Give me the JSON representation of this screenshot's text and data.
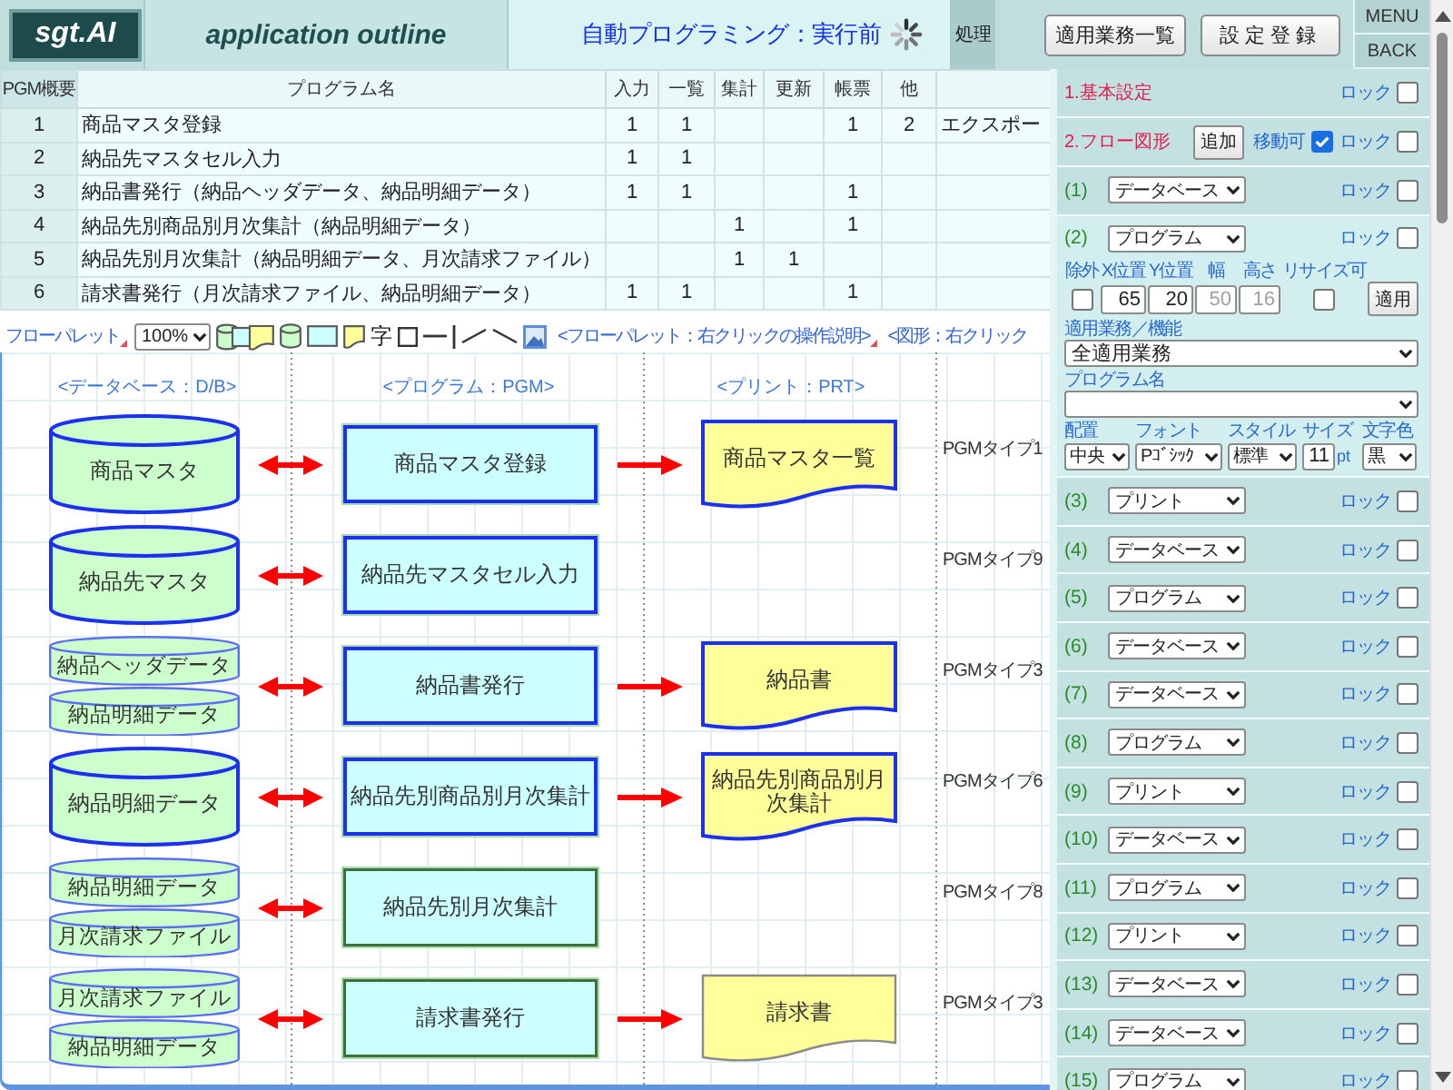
{
  "header": {
    "logo": "sgt.AI",
    "title": "application outline",
    "status": "自動プログラミング：実行前",
    "process_tab": "処理"
  },
  "header_buttons": [
    {
      "label": "適用業務一覧"
    },
    {
      "label": "設定登録"
    }
  ],
  "nav_buttons": [
    {
      "label": "MENU"
    },
    {
      "label": "BACK"
    }
  ],
  "program_table": {
    "columns": [
      "PGM概要",
      "プログラム名",
      "入力",
      "一覧",
      "集計",
      "更新",
      "帳票",
      "他"
    ],
    "rows": [
      {
        "number": "1",
        "name": "商品マスタ登録",
        "input": "1",
        "list": "1",
        "report": "1",
        "other": "2",
        "column_9": "エクスポー"
      },
      {
        "number": "2",
        "name": "納品先マスタセル入力",
        "input": "1",
        "list": "1"
      },
      {
        "number": "3",
        "name": "納品書発行（納品ヘッダデータ、納品明細データ）",
        "input": "1",
        "list": "1",
        "report": "1"
      },
      {
        "number": "4",
        "name": "納品先別商品別月次集計（納品明細データ）",
        "aggregate": "1",
        "report": "1"
      },
      {
        "number": "5",
        "name": "納品先別月次集計（納品明細データ、月次請求ファイル）",
        "aggregate": "1",
        "update": "1"
      },
      {
        "number": "6",
        "name": "請求書発行（月次請求ファイル、納品明細データ）",
        "input": "1",
        "list": "1",
        "report": "1"
      }
    ]
  },
  "flow_toolbar": {
    "label": {
      "text": "フローパレット",
      "marked": true
    },
    "zoom": "100%",
    "text_tool": "字",
    "help_links": [
      {
        "text": "<フローパレット：右クリックの操作説明>",
        "marked": true
      },
      {
        "text": "<図形：右クリック",
        "marked": false
      }
    ]
  },
  "diagram": {
    "column_headers": [
      "<データベース：D/B>",
      "<プログラム：PGM>",
      "<プリント：PRT>"
    ],
    "rows": [
      {
        "databases": [
          "商品マスタ"
        ],
        "program": {
          "label": "商品マスタ登録",
          "highlighted": true
        },
        "print": {
          "label": "商品マスタ一覧",
          "highlighted": true
        },
        "type_label": "PGMタイプ1"
      },
      {
        "databases": [
          "納品先マスタ"
        ],
        "program": {
          "label": "納品先マスタセル入力",
          "highlighted": true
        },
        "type_label": "PGMタイプ9"
      },
      {
        "databases": [
          "納品ヘッダデータ",
          "納品明細データ"
        ],
        "program": {
          "label": "納品書発行",
          "highlighted": true
        },
        "print": {
          "label": "納品書",
          "highlighted": true
        },
        "type_label": "PGMタイプ3"
      },
      {
        "databases": [
          "納品明細データ"
        ],
        "program": {
          "label": "納品先別商品別月次集計",
          "highlighted": true
        },
        "print": {
          "label": "納品先別商品別月次集計",
          "highlighted": true
        },
        "type_label": "PGMタイプ6"
      },
      {
        "databases": [
          "納品明細データ",
          "月次請求ファイル"
        ],
        "program": {
          "label": "納品先別月次集計",
          "highlighted": false
        },
        "type_label": "PGMタイプ8"
      },
      {
        "databases": [
          "月次請求ファイル",
          "納品明細データ"
        ],
        "program": {
          "label": "請求書発行",
          "highlighted": false
        },
        "print": {
          "label": "請求書",
          "highlighted": false
        },
        "type_label": "PGMタイプ3"
      }
    ]
  },
  "settings_panel": {
    "basic": {
      "title": "1.基本設定",
      "lock_label": "ロック",
      "locked": false
    },
    "flow": {
      "title": "2.フロー図形",
      "add_button": "追加",
      "move_label": "移動可",
      "movable": true,
      "lock_label": "ロック",
      "locked": false
    },
    "shapes": [
      {
        "number": "(1)",
        "type": "データベース",
        "lock_label": "ロック",
        "locked": false,
        "expanded": false
      },
      {
        "number": "(2)",
        "type": "プログラム",
        "lock_label": "ロック",
        "locked": false,
        "expanded": true,
        "detail": {
          "position_fields": [
            {
              "label": "除外",
              "kind": "checkbox",
              "checked": false
            },
            {
              "label": "X位置",
              "kind": "number",
              "value": "65",
              "disabled": false
            },
            {
              "label": "Y位置",
              "kind": "number",
              "value": "20",
              "disabled": false
            },
            {
              "label": "幅",
              "kind": "number",
              "value": "50",
              "disabled": true
            },
            {
              "label": "高さ",
              "kind": "number",
              "value": "16",
              "disabled": true
            },
            {
              "label": "リサイズ可",
              "kind": "checkbox",
              "checked": false
            }
          ],
          "apply_button": "適用",
          "business_label": "適用業務／機能",
          "business_value": "全適用業務",
          "program_name_label": "プログラム名",
          "format_fields": [
            {
              "label": "配置",
              "kind": "select",
              "value": "中央"
            },
            {
              "label": "フォント",
              "kind": "select",
              "value": "Pｺﾞｼｯｸ"
            },
            {
              "label": "スタイル",
              "kind": "select",
              "value": "標準"
            },
            {
              "label": "サイズ",
              "kind": "number",
              "value": "11",
              "unit": "pt"
            },
            {
              "label": "文字色",
              "kind": "select",
              "value": "黒"
            }
          ]
        }
      },
      {
        "number": "(3)",
        "type": "プリント",
        "lock_label": "ロック",
        "locked": false,
        "expanded": false
      },
      {
        "number": "(4)",
        "type": "データベース",
        "lock_label": "ロック",
        "locked": false,
        "expanded": false
      },
      {
        "number": "(5)",
        "type": "プログラム",
        "lock_label": "ロック",
        "locked": false,
        "expanded": false
      },
      {
        "number": "(6)",
        "type": "データベース",
        "lock_label": "ロック",
        "locked": false,
        "expanded": false
      },
      {
        "number": "(7)",
        "type": "データベース",
        "lock_label": "ロック",
        "locked": false,
        "expanded": false
      },
      {
        "number": "(8)",
        "type": "プログラム",
        "lock_label": "ロック",
        "locked": false,
        "expanded": false
      },
      {
        "number": "(9)",
        "type": "プリント",
        "lock_label": "ロック",
        "locked": false,
        "expanded": false
      },
      {
        "number": "(10)",
        "type": "データベース",
        "lock_label": "ロック",
        "locked": false,
        "expanded": false
      },
      {
        "number": "(11)",
        "type": "プログラム",
        "lock_label": "ロック",
        "locked": false,
        "expanded": false
      },
      {
        "number": "(12)",
        "type": "プリント",
        "lock_label": "ロック",
        "locked": false,
        "expanded": false
      },
      {
        "number": "(13)",
        "type": "データベース",
        "lock_label": "ロック",
        "locked": false,
        "expanded": false
      },
      {
        "number": "(14)",
        "type": "データベース",
        "lock_label": "ロック",
        "locked": false,
        "expanded": false
      },
      {
        "number": "(15)",
        "type": "プログラム",
        "lock_label": "ロック",
        "locked": false,
        "expanded": false
      }
    ]
  }
}
